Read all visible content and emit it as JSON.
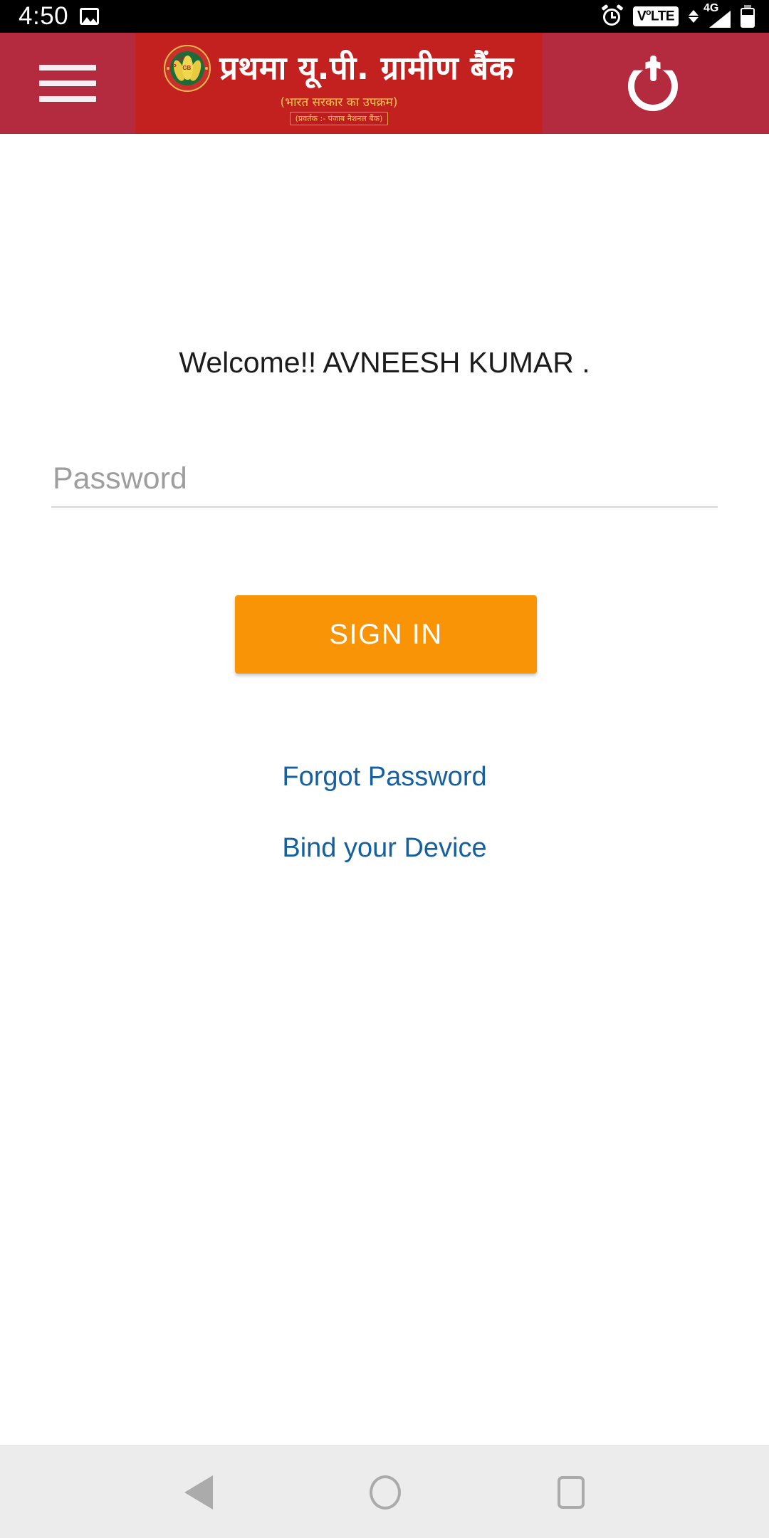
{
  "status_bar": {
    "time": "4:50",
    "icons": {
      "photo": "photo-icon",
      "alarm": "alarm-icon",
      "volte_label": "V",
      "volte_sup": "o",
      "volte_rest": "LTE",
      "network": "4G",
      "battery": "battery-icon"
    }
  },
  "app_bar": {
    "menu": "hamburger-menu-icon",
    "logout": "power-logout-icon",
    "logo": {
      "bank_name": "प्रथमा यू.पी. ग्रामीण बैंक",
      "subtitle": "(भारत सरकार का उपक्रम)",
      "sponsor": "(प्रवर्तक :- पंजाब नैशनल बैंक)",
      "emblem_up": "UP",
      "emblem_p": "P",
      "emblem_gb": "GB"
    },
    "colors": {
      "bar": "#B42A3F",
      "banner": "#C32020",
      "accent_gold": "#F2C94C"
    }
  },
  "main": {
    "welcome_text": "Welcome!! AVNEESH KUMAR .",
    "password": {
      "value": "",
      "placeholder": "Password"
    },
    "sign_in_label": "SIGN IN",
    "links": [
      {
        "label": "Forgot Password"
      },
      {
        "label": "Bind your Device"
      }
    ],
    "colors": {
      "button": "#F89406",
      "link": "#15609F"
    }
  },
  "nav_bar": {
    "back": "back-triangle-icon",
    "home": "home-circle-icon",
    "recents": "recents-square-icon"
  }
}
